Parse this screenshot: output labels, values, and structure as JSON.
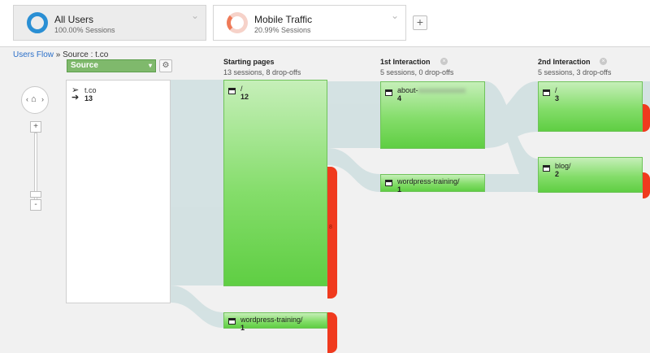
{
  "segments": [
    {
      "name": "All Users",
      "pct": "100.00% Sessions",
      "color": "#2a8fd4"
    },
    {
      "name": "Mobile Traffic",
      "pct": "20.99% Sessions",
      "color": "#ef7a58"
    }
  ],
  "add_segment_label": "+",
  "breadcrumb": {
    "link": "Users Flow",
    "sep": "»",
    "current": "Source : t.co"
  },
  "source_dropdown": {
    "label": "Source",
    "caret": "▾"
  },
  "settings_glyph": "⚙",
  "zoom": {
    "plus": "+",
    "minus": "-",
    "left": "‹",
    "right": "›",
    "home": "⌂"
  },
  "columns": [
    {
      "title": "Starting pages",
      "subtitle": "13 sessions, 8 drop-offs"
    },
    {
      "title": "1st Interaction",
      "subtitle": "5 sessions, 0 drop-offs",
      "close": "×"
    },
    {
      "title": "2nd Interaction",
      "subtitle": "5 sessions, 3 drop-offs",
      "close": "×"
    }
  ],
  "source_node": {
    "arrows": "↘\n➜",
    "name": "t.co",
    "count": "13"
  },
  "nodes": {
    "start_root": {
      "name": "/",
      "count": "12"
    },
    "start_wp": {
      "name": "wordpress-training/",
      "count": "1"
    },
    "int1_about": {
      "name": "about-",
      "name_blurred": "xxxxxxxxxxxxx",
      "count": "4"
    },
    "int1_wp": {
      "name": "wordpress-training/",
      "count": "1"
    },
    "int2_root": {
      "name": "/",
      "count": "3"
    },
    "int2_blog": {
      "name": "blog/",
      "count": "2"
    }
  },
  "dropoff_marker": "8"
}
